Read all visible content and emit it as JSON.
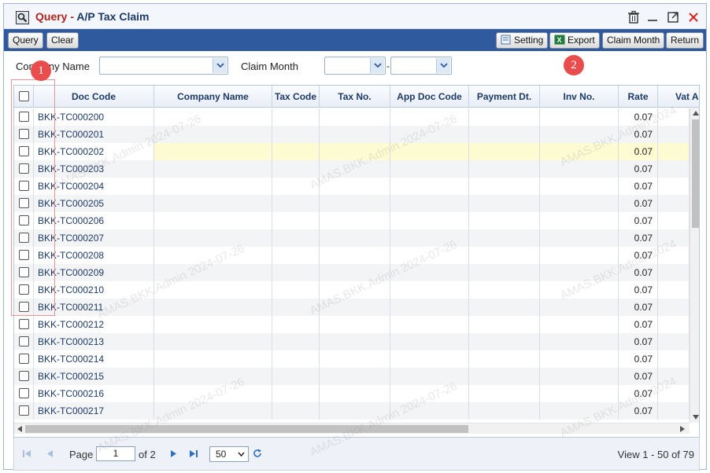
{
  "window": {
    "title_query": "Query",
    "title_sep": " - ",
    "title_main": "A/P Tax Claim"
  },
  "toolbar": {
    "query_label": "Query",
    "clear_label": "Clear",
    "setting_label": "Setting",
    "export_label": "Export",
    "claim_month_label": "Claim Month",
    "return_label": "Return"
  },
  "filters": {
    "company_name_label": "Company Name",
    "company_name_value": "",
    "claim_month_label": "Claim Month",
    "claim_month_from": "",
    "claim_month_to": "",
    "range_separator": "-"
  },
  "annotations": {
    "badge1": "1",
    "badge2": "2"
  },
  "grid": {
    "columns": [
      "Doc Code",
      "Company Name",
      "Tax Code",
      "Tax No.",
      "App Doc Code",
      "Payment Dt.",
      "Inv No.",
      "Rate",
      "Vat Am"
    ],
    "rows": [
      {
        "doc_code": "BKK-TC000200",
        "rate": "0.07"
      },
      {
        "doc_code": "BKK-TC000201",
        "rate": "0.07"
      },
      {
        "doc_code": "BKK-TC000202",
        "rate": "0.07"
      },
      {
        "doc_code": "BKK-TC000203",
        "rate": "0.07"
      },
      {
        "doc_code": "BKK-TC000204",
        "rate": "0.07"
      },
      {
        "doc_code": "BKK-TC000205",
        "rate": "0.07"
      },
      {
        "doc_code": "BKK-TC000206",
        "rate": "0.07"
      },
      {
        "doc_code": "BKK-TC000207",
        "rate": "0.07"
      },
      {
        "doc_code": "BKK-TC000208",
        "rate": "0.07"
      },
      {
        "doc_code": "BKK-TC000209",
        "rate": "0.07"
      },
      {
        "doc_code": "BKK-TC000210",
        "rate": "0.07"
      },
      {
        "doc_code": "BKK-TC000211",
        "rate": "0.07"
      },
      {
        "doc_code": "BKK-TC000212",
        "rate": "0.07"
      },
      {
        "doc_code": "BKK-TC000213",
        "rate": "0.07"
      },
      {
        "doc_code": "BKK-TC000214",
        "rate": "0.07"
      },
      {
        "doc_code": "BKK-TC000215",
        "rate": "0.07"
      },
      {
        "doc_code": "BKK-TC000216",
        "rate": "0.07"
      },
      {
        "doc_code": "BKK-TC000217",
        "rate": "0.07"
      }
    ],
    "highlighted_row": "BKK-TC000202"
  },
  "pager": {
    "page_label": "Page",
    "current_page": "1",
    "of_label": "of 2",
    "page_size": "50",
    "view_text": "View 1 - 50 of 79"
  },
  "watermark": {
    "text_a": "AMAS.BKK.Admin 2024-07-26",
    "text_b": "AMAS.BKK.Admin 2024"
  },
  "colors": {
    "toolbar_bg": "#2f5a9e",
    "title_accent": "#b0231f",
    "header_text": "#1d3a66",
    "badge": "#e84c4c",
    "highlight_row": "#fdfbd2"
  }
}
